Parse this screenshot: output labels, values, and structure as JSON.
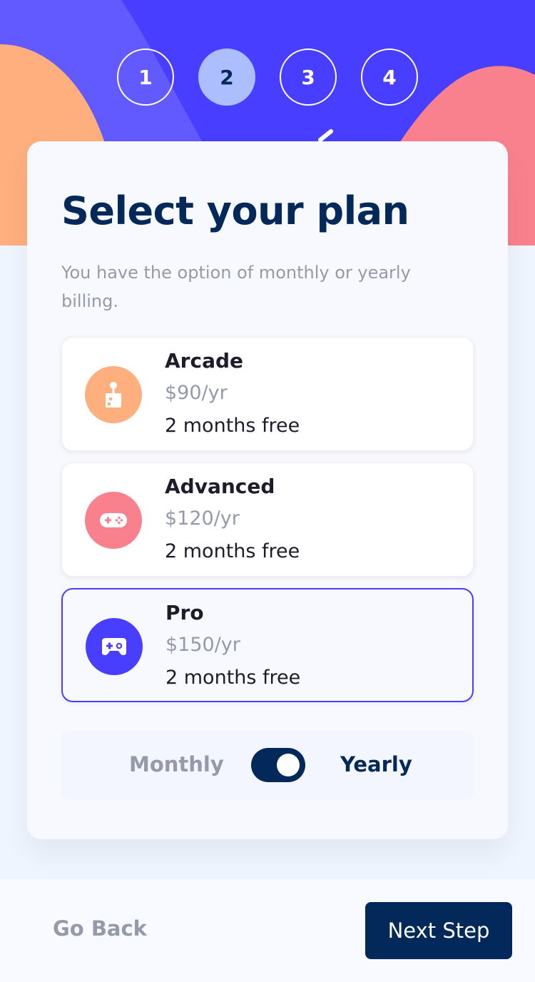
{
  "colors": {
    "hero_background": "#483eff",
    "marine_blue": "#022959",
    "purple": "#483eff",
    "light_blue": "#adbeff",
    "orange": "#ffaf7e",
    "pink": "#f9818e",
    "grey": "#9699aa"
  },
  "steps": [
    {
      "number": "1",
      "active": false
    },
    {
      "number": "2",
      "active": true
    },
    {
      "number": "3",
      "active": false
    },
    {
      "number": "4",
      "active": false
    }
  ],
  "header": {
    "title": "Select your plan",
    "subtitle": "You have the option of monthly or yearly billing."
  },
  "plans": [
    {
      "name": "Arcade",
      "price": "$90/yr",
      "promo": "2 months free",
      "icon": "joystick-icon",
      "color": "#ffaf7e",
      "selected": false
    },
    {
      "name": "Advanced",
      "price": "$120/yr",
      "promo": "2 months free",
      "icon": "gamepad-icon",
      "color": "#f9818e",
      "selected": false
    },
    {
      "name": "Pro",
      "price": "$150/yr",
      "promo": "2 months free",
      "icon": "controller-icon",
      "color": "#483eff",
      "selected": true
    }
  ],
  "billing": {
    "monthly_label": "Monthly",
    "yearly_label": "Yearly",
    "selected": "Yearly"
  },
  "footer": {
    "back_label": "Go Back",
    "next_label": "Next Step"
  }
}
